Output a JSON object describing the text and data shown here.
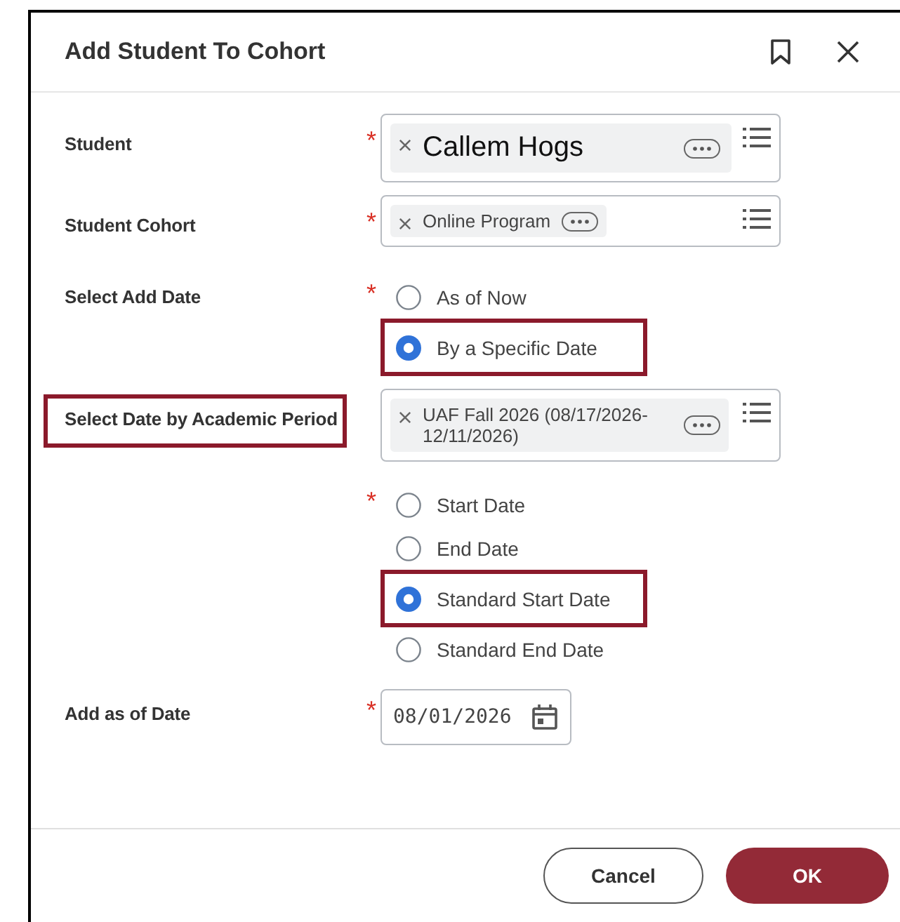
{
  "dialog": {
    "title": "Add Student To Cohort"
  },
  "fields": [
    {
      "kind": "chips",
      "label": "Student",
      "required_mark": "*",
      "highlighted": false,
      "chips": [
        {
          "text": "Callem Hogs",
          "kind": "large"
        }
      ]
    },
    {
      "kind": "chips",
      "label": "Student Cohort",
      "required_mark": "*",
      "highlighted": false,
      "chips": [
        {
          "text": "Online Program",
          "kind": "normal"
        }
      ]
    },
    {
      "kind": "radio",
      "label": "Select Add Date",
      "required_mark": "*",
      "highlighted": false,
      "options": [
        {
          "text": "As of Now",
          "selected": false,
          "highlighted": false
        },
        {
          "text": "By a Specific Date",
          "selected": true,
          "highlighted": true
        }
      ]
    },
    {
      "kind": "chips",
      "label": "Select Date by Academic Period",
      "highlighted": true,
      "chips": [
        {
          "text": "UAF Fall 2026 (08/17/2026-12/11/2026)",
          "kind": "normal"
        }
      ]
    },
    {
      "kind": "radio",
      "required_mark": "*",
      "options": [
        {
          "text": "Start Date",
          "selected": false,
          "highlighted": false
        },
        {
          "text": "End Date",
          "selected": false,
          "highlighted": false
        },
        {
          "text": "Standard Start Date",
          "selected": true,
          "highlighted": true
        },
        {
          "text": "Standard End Date",
          "selected": false,
          "highlighted": false
        }
      ]
    },
    {
      "kind": "date",
      "label": "Add as of Date",
      "required_mark": "*",
      "highlighted": false,
      "value": "08/01/2026"
    }
  ],
  "buttons": [
    {
      "text": "Cancel",
      "kind": "secondary"
    },
    {
      "text": "OK",
      "kind": "primary"
    }
  ]
}
